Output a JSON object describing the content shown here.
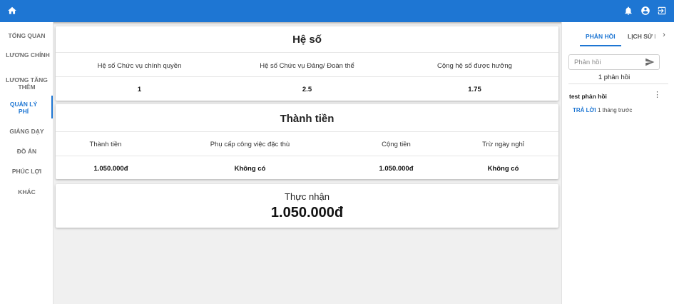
{
  "topbar": {
    "home_icon": "home-icon",
    "icons": [
      "bell-icon",
      "account-icon",
      "logout-icon"
    ],
    "color": "#1e76d3"
  },
  "sidebar": {
    "items": [
      {
        "label": "TỔNG QUAN",
        "active": false
      },
      {
        "label": "LƯƠNG CHÍNH",
        "active": false
      },
      {
        "label": "LƯƠNG TĂNG THÊM",
        "active": false
      },
      {
        "label": "QUẢN LÝ PHÍ",
        "active": true
      },
      {
        "label": "GIẢNG DẠY",
        "active": false
      },
      {
        "label": "ĐỒ ÁN",
        "active": false
      },
      {
        "label": "PHÚC LỢI",
        "active": false
      },
      {
        "label": "KHÁC",
        "active": false
      }
    ]
  },
  "he_so": {
    "title": "Hệ số",
    "headers": [
      "Hệ số Chức vụ chính quyền",
      "Hệ số Chức vụ Đảng/ Đoàn thể",
      "Cộng hệ số được hưởng"
    ],
    "values": [
      "1",
      "2.5",
      "1.75"
    ]
  },
  "thanh_tien": {
    "title": "Thành tiền",
    "headers": [
      "Thành tiền",
      "Phụ cấp công việc đặc thù",
      "Cộng tiền",
      "Trừ ngày nghỉ"
    ],
    "values": [
      "1.050.000đ",
      "Không có",
      "1.050.000đ",
      "Không có"
    ]
  },
  "thuc_nhan": {
    "label": "Thực nhận",
    "amount": "1.050.000đ"
  },
  "feedback": {
    "tabs": [
      "PHẢN HỒI",
      "LỊCH SỬ I"
    ],
    "active_tab": 0,
    "input_placeholder": "Phản hồi",
    "count_text": "1 phản hồi",
    "comments": [
      {
        "author": "test phản hồi",
        "reply_label": "TRẢ LỜI",
        "time": "1 tháng trước"
      }
    ]
  }
}
